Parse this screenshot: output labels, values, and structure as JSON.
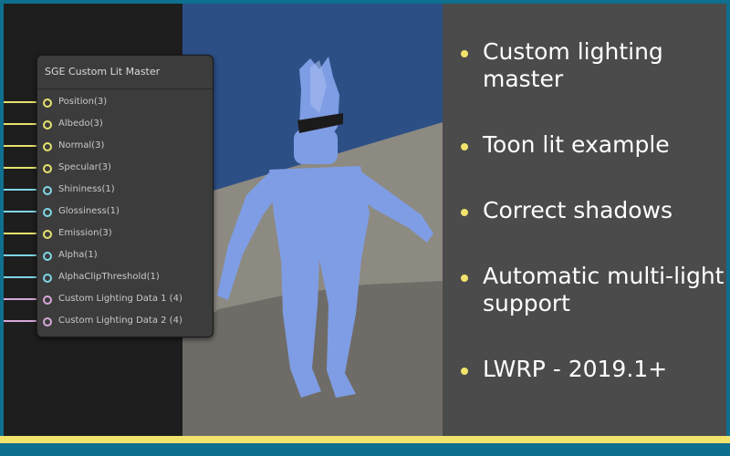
{
  "node": {
    "title": "SGE Custom Lit Master",
    "ports": [
      {
        "label": "Position(3)",
        "color": "#e6e36f"
      },
      {
        "label": "Albedo(3)",
        "color": "#e6e36f"
      },
      {
        "label": "Normal(3)",
        "color": "#e6e36f"
      },
      {
        "label": "Specular(3)",
        "color": "#e6e36f"
      },
      {
        "label": "Shininess(1)",
        "color": "#7fd7e6"
      },
      {
        "label": "Glossiness(1)",
        "color": "#7fd7e6"
      },
      {
        "label": "Emission(3)",
        "color": "#e6e36f"
      },
      {
        "label": "Alpha(1)",
        "color": "#7fd7e6"
      },
      {
        "label": "AlphaClipThreshold(1)",
        "color": "#7fd7e6"
      },
      {
        "label": "Custom Lighting Data 1 (4)",
        "color": "#d8a9d8"
      },
      {
        "label": "Custom Lighting Data 2 (4)",
        "color": "#d8a9d8"
      }
    ]
  },
  "bullets": [
    "Custom lighting master",
    "Toon lit example",
    "Correct shadows",
    "Automatic multi-light support",
    "LWRP - 2019.1+"
  ],
  "colors": {
    "accent": "#f1e36c",
    "border": "#0f6f8e",
    "panel": "#4b4b4b",
    "character": "#7f9de4"
  }
}
